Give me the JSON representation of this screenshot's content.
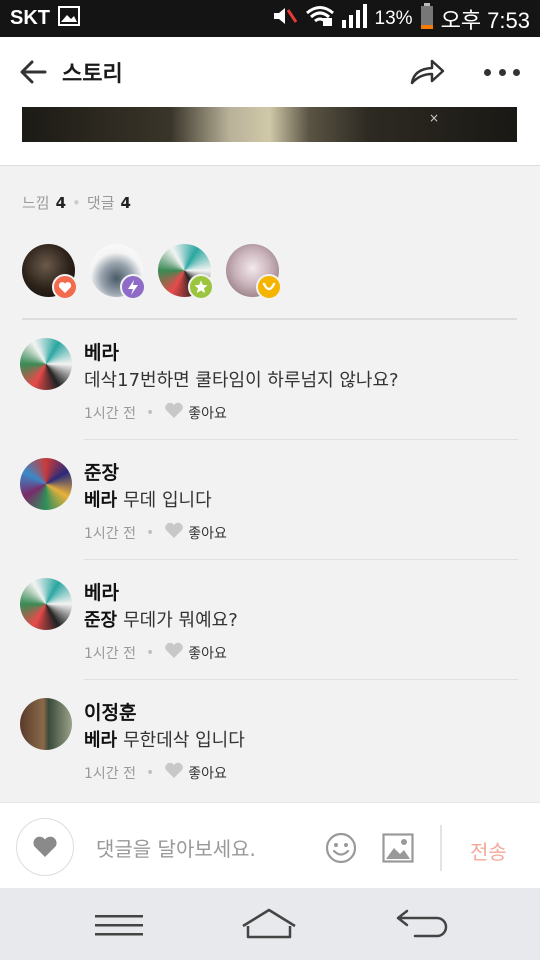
{
  "status_bar": {
    "carrier": "SKT",
    "battery_percent": "13%",
    "time": "오후 7:53"
  },
  "header": {
    "title": "스토리",
    "icons": {
      "back": "back-arrow-icon",
      "share": "share-icon",
      "more": "more-icon"
    }
  },
  "counts": {
    "feel_label": "느낌",
    "feel_count": "4",
    "comment_label": "댓글",
    "comment_count": "4"
  },
  "reactions": [
    {
      "badge": "heart-icon",
      "color": "#f26b4f"
    },
    {
      "badge": "bolt-icon",
      "color": "#8e6bc7"
    },
    {
      "badge": "star-icon",
      "color": "#9bc53d"
    },
    {
      "badge": "smile-icon",
      "color": "#f5b400"
    }
  ],
  "comments": [
    {
      "author": "베라",
      "mention": "",
      "text": "데삭17번하면 쿨타임이 하루넘지 않나요?",
      "time": "1시간 전",
      "like_label": "좋아요"
    },
    {
      "author": "준장",
      "mention": "베라",
      "text": "무데 입니다",
      "time": "1시간 전",
      "like_label": "좋아요"
    },
    {
      "author": "베라",
      "mention": "준장",
      "text": "무데가 뭐예요?",
      "time": "1시간 전",
      "like_label": "좋아요"
    },
    {
      "author": "이정훈",
      "mention": "베라",
      "text": "무한데삭 입니다",
      "time": "1시간 전",
      "like_label": "좋아요"
    }
  ],
  "input_bar": {
    "placeholder": "댓글을 달아보세요.",
    "send_label": "전송",
    "send_color": "#f4a999"
  },
  "nav_bar": {
    "icons": [
      "menu-icon",
      "home-icon",
      "back-icon"
    ]
  }
}
